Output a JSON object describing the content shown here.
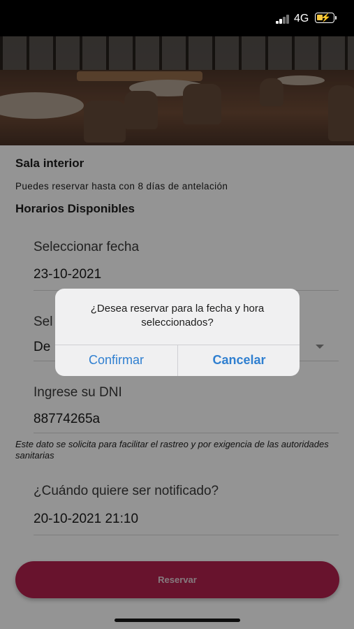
{
  "status_bar": {
    "network": "4G",
    "icons": [
      "signal-icon",
      "battery-charging-icon"
    ]
  },
  "venue": {
    "name": "Sala interior",
    "info": "Puedes reservar hasta con 8 días de antelación",
    "section_title": "Horarios Disponibles"
  },
  "form": {
    "date_label": "Seleccionar fecha",
    "date_value": "23-10-2021",
    "time_label_partial": "Sel",
    "time_value_partial": "De",
    "dni_label": "Ingrese su DNI",
    "dni_value": "88774265a",
    "dni_note": "Este dato se solicita para facilitar el rastreo y por exigencia de las autoridades sanitarias",
    "notify_label": "¿Cuándo quiere ser notificado?",
    "notify_value": "20-10-2021 21:10"
  },
  "reserve_button": {
    "label": "Reservar"
  },
  "dialog": {
    "message": "¿Desea reservar para la fecha y hora seleccionados?",
    "confirm_label": "Confirmar",
    "cancel_label": "Cancelar"
  },
  "colors": {
    "primary": "#b4224e",
    "dialog_action": "#2f7fd0"
  }
}
